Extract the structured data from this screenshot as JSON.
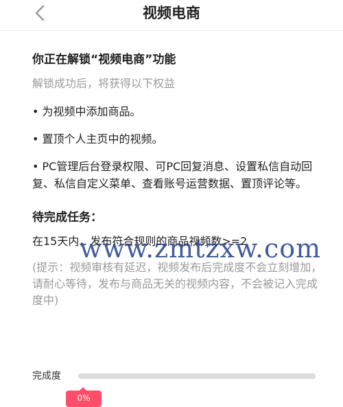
{
  "header": {
    "title": "视频电商",
    "back_icon": "chevron-left-icon"
  },
  "intro": {
    "heading": "你正在解锁“视频电商”功能",
    "subheading": "解锁成功后，将获得以下权益"
  },
  "benefits": [
    "• 为视频中添加商品。",
    "• 置顶个人主页中的视频。",
    "• PC管理后台登录权限、可PC回复消息、设置私信自动回复、私信自定义菜单、查看账号运营数据、置顶评论等。"
  ],
  "task": {
    "title": "待完成任务：",
    "description": "在15天内，发布符合规则的商品视频数>=2",
    "hint": "(提示：视频审核有延迟，视频发布后完成度不会立刻增加，请耐心等待，发布与商品无关的视频内容，不会被记入完成度中)"
  },
  "progress": {
    "label": "完成度",
    "percent": 0,
    "percent_text": "0%",
    "fill_color": "#ff4d6a",
    "track_color": "#dcdcdc"
  },
  "watermark": "www.zmtzxw.com"
}
